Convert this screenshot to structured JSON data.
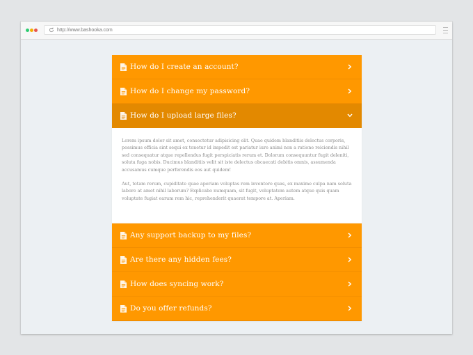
{
  "browser": {
    "url": "http://www.bashooka.com",
    "icons": {
      "reload": "reload-icon",
      "menu": "hamburger-menu-icon"
    }
  },
  "faq": {
    "colors": {
      "item_bg": "#ff9800",
      "active_bg": "#e38900",
      "answer_text": "#8a8a8a"
    },
    "items_before": [
      {
        "question": "How do I create an account?"
      },
      {
        "question": "How do I change my password?"
      }
    ],
    "active": {
      "question": "How do I upload large files?",
      "answer_paragraphs": [
        "Lorem ipsum dolor sit amet, consectetur adipisicing elit. Quae quidem blanditiis delectus corporis, possimus officia sint sequi ex tenetur id impedit est pariatur iure animi non a ratione reiciendis nihil sed consequatur atque repellendus fugit perspiciatis rerum et. Dolorum consequuntur fugit deleniti, soluta fuga nobis. Ducimus blanditiis velit sit iste delectus obcaecati debitis omnis, assumenda accusamus cumque perferendis eos aut quidem!",
        "Aut, totam rerum, cupiditate quae aperiam voluptas rem inventore quas, ex maxime culpa nam soluta labore at amet nihil laborum? Explicabo numquam, sit fugit, voluptatem autem atque quis quam voluptate fugiat earum rem hic, reprehenderit quaerat tempore at. Aperiam."
      ]
    },
    "items_after": [
      {
        "question": "Any support backup to my files?"
      },
      {
        "question": "Are there any hidden fees?"
      },
      {
        "question": "How does syncing work?"
      },
      {
        "question": "Do you offer refunds?"
      }
    ],
    "icons": {
      "item": "document-icon",
      "collapsed": "chevron-right-icon",
      "expanded": "chevron-down-icon"
    }
  }
}
